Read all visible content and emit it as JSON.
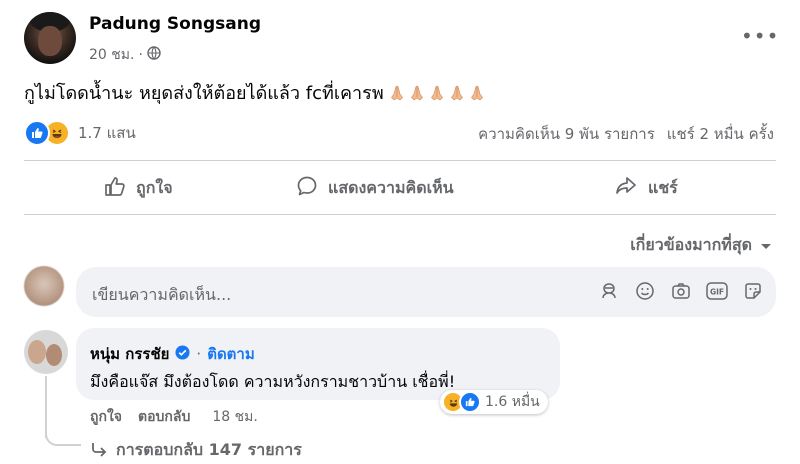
{
  "post": {
    "author": "Padung Songsang",
    "time": "20 ชม.",
    "separator": "·",
    "text": "กูไม่โดดน้ำนะ หยุดส่งให้ต้อยได้แล้ว fcที่เคารพ",
    "emoji_repeat": 5,
    "reaction_count": "1.7 แสน",
    "comments_count": "ความคิดเห็น 9 พัน รายการ",
    "shares_count": "แชร์ 2 หมื่น ครั้ง"
  },
  "actions": {
    "like": "ถูกใจ",
    "comment": "แสดงความคิดเห็น",
    "share": "แชร์"
  },
  "sort": {
    "label": "เกี่ยวข้องมากที่สุด"
  },
  "composer": {
    "placeholder": "เขียนความคิดเห็น..."
  },
  "comment": {
    "author": "หนุ่ม กรรชัย",
    "separator": "·",
    "follow": "ติดตาม",
    "text": "มึงคือแจ๊ส มึงต้องโดด ความหวังกรามชาวบ้าน เชื่อพี่!",
    "reaction_count": "1.6 หมื่น",
    "like": "ถูกใจ",
    "reply": "ตอบกลับ",
    "time": "18 ชม.",
    "replies": "การตอบกลับ 147 รายการ"
  },
  "icons": {
    "more": "more-options-icon",
    "privacy": "globe-icon",
    "like_reaction": "like-reaction-icon",
    "haha_reaction": "haha-reaction-icon",
    "pray": "folded-hands-emoji",
    "verified": "verified-badge-icon",
    "reply_arrow": "reply-arrow-icon"
  },
  "colors": {
    "accent": "#1877f2",
    "secondary_text": "#65676b",
    "bubble": "#f0f2f5",
    "haha": "#f7b125"
  }
}
